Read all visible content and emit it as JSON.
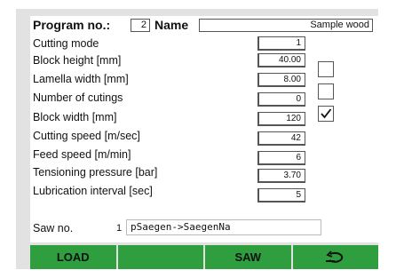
{
  "header": {
    "program_label": "Program no.:",
    "program_value": "2",
    "name_label": "Name",
    "name_value": "Sample wood"
  },
  "parameters": [
    {
      "label": "Cutting mode",
      "value": "1"
    },
    {
      "label": "Block height [mm]",
      "value": "40.00"
    },
    {
      "label": "Lamella width [mm]",
      "value": "8.00"
    },
    {
      "label": "Number of cutings",
      "value": "0"
    },
    {
      "label": "Block width [mm]",
      "value": "120"
    },
    {
      "label": "Cutting speed [m/sec]",
      "value": "42"
    },
    {
      "label": "Feed speed [m/min]",
      "value": "6"
    },
    {
      "label": "Tensioning pressure [bar]",
      "value": "3.70"
    },
    {
      "label": "Lubrication interval [sec]",
      "value": "5"
    }
  ],
  "checkboxes": [
    {
      "row": "Block height [mm]",
      "checked": false
    },
    {
      "row": "Lamella width [mm]",
      "checked": false
    },
    {
      "row": "Number of cutings",
      "checked": true
    }
  ],
  "saw": {
    "label": "Saw no.",
    "number": "1",
    "value": "pSaegen->SaegenNa"
  },
  "softkeys": {
    "load": "LOAD",
    "empty": "",
    "saw": "SAW",
    "back_icon": "return-arrow-icon"
  },
  "colors": {
    "softkey_green": "#2e9e3e",
    "frame_gray": "#e2e2e2"
  }
}
